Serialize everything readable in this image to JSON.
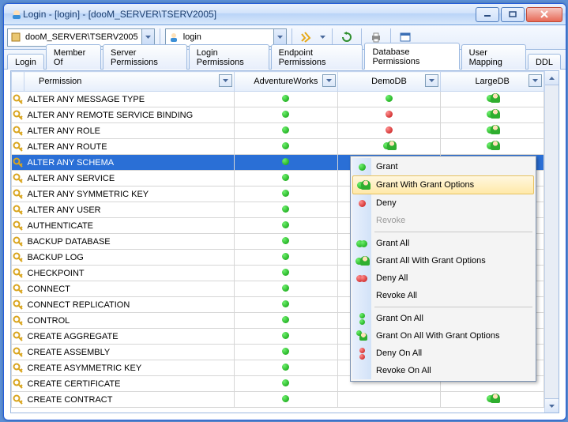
{
  "window": {
    "title": "Login - [login] - [dooM_SERVER\\TSERV2005]"
  },
  "toolbar": {
    "server_combo": "dooM_SERVER\\TSERV2005",
    "login_combo": "login"
  },
  "tabs": [
    {
      "label": "Login"
    },
    {
      "label": "Member Of"
    },
    {
      "label": "Server Permissions"
    },
    {
      "label": "Login Permissions"
    },
    {
      "label": "Endpoint Permissions"
    },
    {
      "label": "Database Permissions",
      "active": true
    },
    {
      "label": "User Mapping"
    },
    {
      "label": "DDL"
    }
  ],
  "grid": {
    "cols": [
      "Permission",
      "AdventureWorks",
      "DemoDB",
      "LargeDB"
    ],
    "rows": [
      {
        "perm": "ALTER ANY MESSAGE TYPE",
        "c": [
          "g",
          "g",
          "p"
        ]
      },
      {
        "perm": "ALTER ANY REMOTE SERVICE BINDING",
        "c": [
          "g",
          "r",
          "p"
        ]
      },
      {
        "perm": "ALTER ANY ROLE",
        "c": [
          "g",
          "r",
          "p"
        ]
      },
      {
        "perm": "ALTER ANY ROUTE",
        "c": [
          "g",
          "p",
          "p"
        ]
      },
      {
        "perm": "ALTER ANY SCHEMA",
        "sel": true,
        "c": [
          "g",
          "",
          ""
        ]
      },
      {
        "perm": "ALTER ANY SERVICE",
        "c": [
          "g",
          "",
          ""
        ]
      },
      {
        "perm": "ALTER ANY SYMMETRIC KEY",
        "c": [
          "g",
          "",
          ""
        ]
      },
      {
        "perm": "ALTER ANY USER",
        "c": [
          "g",
          "",
          ""
        ]
      },
      {
        "perm": "AUTHENTICATE",
        "c": [
          "g",
          "",
          ""
        ]
      },
      {
        "perm": "BACKUP DATABASE",
        "c": [
          "g",
          "",
          ""
        ]
      },
      {
        "perm": "BACKUP LOG",
        "c": [
          "g",
          "",
          ""
        ]
      },
      {
        "perm": "CHECKPOINT",
        "c": [
          "g",
          "",
          ""
        ]
      },
      {
        "perm": "CONNECT",
        "c": [
          "g",
          "",
          ""
        ]
      },
      {
        "perm": "CONNECT REPLICATION",
        "c": [
          "g",
          "",
          ""
        ]
      },
      {
        "perm": "CONTROL",
        "c": [
          "g",
          "",
          ""
        ]
      },
      {
        "perm": "CREATE AGGREGATE",
        "c": [
          "g",
          "",
          ""
        ]
      },
      {
        "perm": "CREATE ASSEMBLY",
        "c": [
          "g",
          "",
          ""
        ]
      },
      {
        "perm": "CREATE ASYMMETRIC KEY",
        "c": [
          "g",
          "",
          ""
        ]
      },
      {
        "perm": "CREATE CERTIFICATE",
        "c": [
          "g",
          "",
          ""
        ]
      },
      {
        "perm": "CREATE CONTRACT",
        "c": [
          "g",
          "",
          "p"
        ]
      }
    ]
  },
  "context_menu": {
    "items": [
      {
        "label": "Grant",
        "icon": "g"
      },
      {
        "label": "Grant With Grant Options",
        "icon": "p",
        "hl": true
      },
      {
        "label": "Deny",
        "icon": "r"
      },
      {
        "label": "Revoke",
        "disabled": true
      },
      {
        "sep": true
      },
      {
        "label": "Grant All",
        "icon": "gg"
      },
      {
        "label": "Grant All With Grant Options",
        "icon": "pp"
      },
      {
        "label": "Deny All",
        "icon": "rr"
      },
      {
        "label": "Revoke All"
      },
      {
        "sep": true
      },
      {
        "label": "Grant On All",
        "icon": "g2"
      },
      {
        "label": "Grant On All With Grant Options",
        "icon": "p2"
      },
      {
        "label": "Deny On All",
        "icon": "r2"
      },
      {
        "label": "Revoke On All"
      }
    ]
  }
}
